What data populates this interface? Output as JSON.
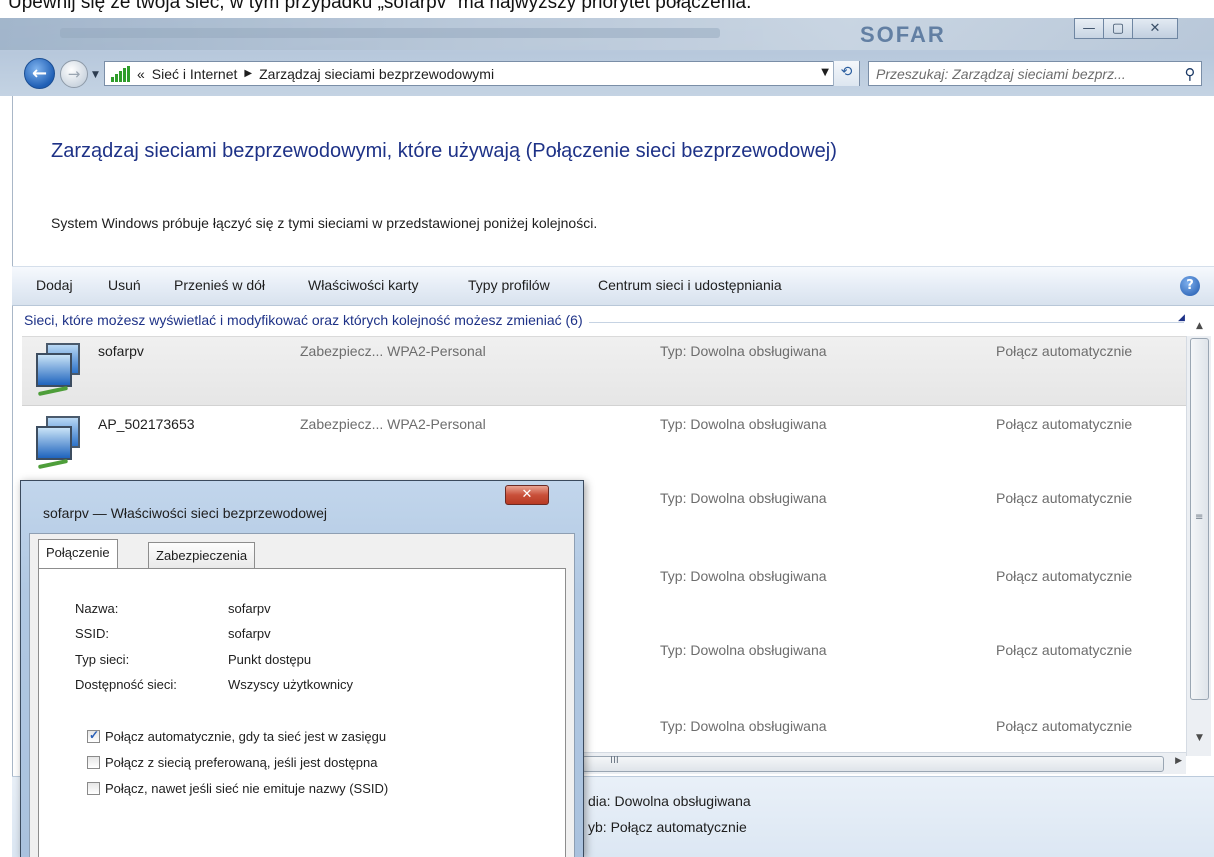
{
  "doc_caption": "Upewnij się że twoja sieć, w tym przypadku „sofarpv” ma najwyższy priorytet połączenia.",
  "window": {
    "brand": "SOFAR",
    "buttons": {
      "minimize": "—",
      "maximize": "▢",
      "close": "✕"
    }
  },
  "nav": {
    "back": "←",
    "forward": "→",
    "address_prefix": "«",
    "breadcrumb": [
      "Sieć i Internet",
      "Zarządzaj sieciami bezprzewodowymi"
    ],
    "search_placeholder": "Przeszukaj: Zarządzaj sieciami bezprz..."
  },
  "page": {
    "title": "Zarządzaj sieciami bezprzewodowymi, które używają (Połączenie sieci bezprzewodowej)",
    "description": "System Windows próbuje łączyć się z tymi sieciami w przedstawionej poniżej kolejności."
  },
  "toolbar": {
    "items": [
      "Dodaj",
      "Usuń",
      "Przenieś w dół",
      "Właściwości karty",
      "Typy profilów",
      "Centrum sieci i udostępniania"
    ],
    "help": "?"
  },
  "group_header": "Sieci, które możesz wyświetlać i modyfikować oraz których kolejność możesz zmieniać (6)",
  "networks": [
    {
      "name": "sofarpv",
      "security": "Zabezpiecz... WPA2-Personal",
      "type": "Typ: Dowolna obsługiwana",
      "connect": "Połącz automatycznie"
    },
    {
      "name": "AP_502173653",
      "security": "Zabezpiecz... WPA2-Personal",
      "type": "Typ: Dowolna obsługiwana",
      "connect": "Połącz automatycznie"
    },
    {
      "name": "",
      "security": "",
      "type": "Typ: Dowolna obsługiwana",
      "connect": "Połącz automatycznie"
    },
    {
      "name": "",
      "security": "",
      "type": "Typ: Dowolna obsługiwana",
      "connect": "Połącz automatycznie"
    },
    {
      "name": "",
      "security": "",
      "type": "Typ: Dowolna obsługiwana",
      "connect": "Połącz automatycznie"
    },
    {
      "name": "",
      "security": "",
      "type": "Typ: Dowolna obsługiwana",
      "connect": "Połącz automatycznie"
    }
  ],
  "details": {
    "line1": "dia: Dowolna obsługiwana",
    "line2": "yb: Połącz automatycznie"
  },
  "dialog": {
    "title": "sofarpv — Właściwości sieci bezprzewodowej",
    "close": "✕",
    "tabs": [
      "Połączenie",
      "Zabezpieczenia"
    ],
    "properties": [
      {
        "label": "Nazwa:",
        "value": "sofarpv"
      },
      {
        "label": "SSID:",
        "value": "sofarpv"
      },
      {
        "label": "Typ sieci:",
        "value": "Punkt dostępu"
      },
      {
        "label": "Dostępność sieci:",
        "value": "Wszyscy użytkownicy"
      }
    ],
    "checkboxes": [
      {
        "label": "Połącz automatycznie, gdy ta sieć jest w zasięgu",
        "checked": true
      },
      {
        "label": "Połącz z siecią preferowaną, jeśli jest dostępna",
        "checked": false
      },
      {
        "label": "Połącz, nawet jeśli sieć nie emituje nazwy (SSID)",
        "checked": false
      }
    ]
  },
  "colors": {
    "title_blue": "#1e3287",
    "dialog_frame": "#b1c8e2",
    "close_red": "#c9503a"
  }
}
